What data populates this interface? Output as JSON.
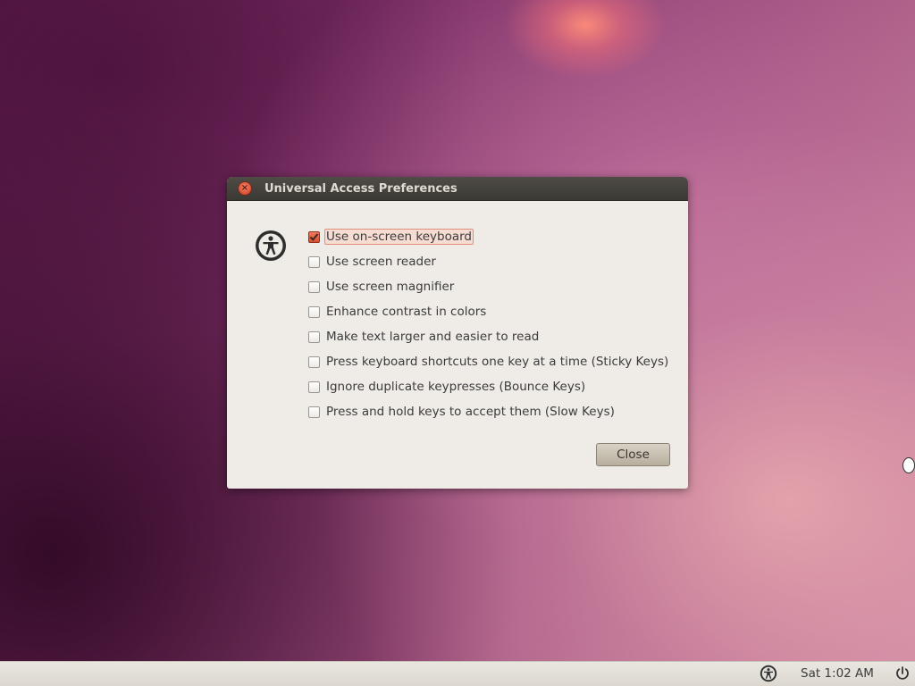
{
  "dialog": {
    "title": "Universal Access Preferences",
    "options": [
      {
        "label": "Use on-screen keyboard",
        "checked": true
      },
      {
        "label": "Use screen reader",
        "checked": false
      },
      {
        "label": "Use screen magnifier",
        "checked": false
      },
      {
        "label": "Enhance contrast in colors",
        "checked": false
      },
      {
        "label": "Make text larger and easier to read",
        "checked": false
      },
      {
        "label": "Press keyboard shortcuts one key at a time (Sticky Keys)",
        "checked": false
      },
      {
        "label": "Ignore duplicate keypresses (Bounce Keys)",
        "checked": false
      },
      {
        "label": "Press and hold keys to accept them (Slow Keys)",
        "checked": false
      }
    ],
    "close_label": "Close",
    "close_icon_glyph": "×"
  },
  "panel": {
    "clock": "Sat  1:02 AM"
  },
  "icons": {
    "dialog_icon": "accessibility-icon",
    "panel_accessibility": "accessibility-icon",
    "panel_power": "power-icon",
    "title_close": "close-icon"
  },
  "colors": {
    "accent": "#e0573a",
    "titlebar": "#3b3934",
    "dialog_bg": "#efebe7",
    "panel_bg": "#dcd8d0"
  }
}
